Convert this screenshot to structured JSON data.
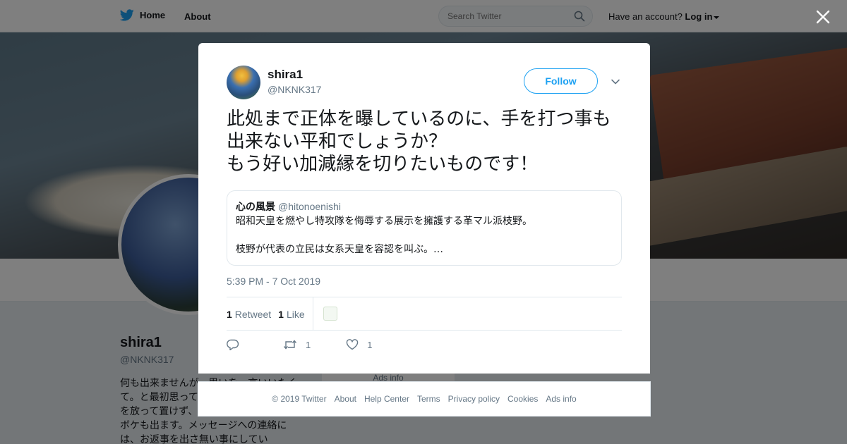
{
  "topbar": {
    "home_label": "Home",
    "about_label": "About",
    "search_placeholder": "Search Twitter",
    "have_account": "Have an account?",
    "login_label": "Log in"
  },
  "profile": {
    "name": "shira1",
    "handle": "@NKNK317",
    "bio": "何も出来ませんが、思いを一言いいたくて。と最初思って始めましたが、此の国を放って置けず、物申す方向になり時々ボケも出ます。メッセージへの連絡には、お返事を出さ無い事にしてい",
    "ads_info": "Ads info"
  },
  "tweet": {
    "author_name": "shira1",
    "author_handle": "@NKNK317",
    "follow_label": "Follow",
    "text": "此処まで正体を曝しているのに、手を打つ事も出来ない平和でしょうか？\nもう好い加減縁を切りたいものです！",
    "quoted": {
      "name": "心の風景",
      "handle": "@hitonoenishi",
      "line1": "昭和天皇を燃やし特攻隊を侮辱する展示を擁護する革マル派枝野。",
      "line2": "枝野が代表の立民は女系天皇を容認を叫ぶ。…"
    },
    "timestamp": "5:39 PM - 7 Oct 2019",
    "retweets_count": "1",
    "retweets_label": "Retweet",
    "likes_count": "1",
    "likes_label": "Like",
    "action_retweet_count": "1",
    "action_like_count": "1"
  },
  "footer": {
    "links": [
      "© 2019 Twitter",
      "About",
      "Help Center",
      "Terms",
      "Privacy policy",
      "Cookies",
      "Ads info"
    ]
  },
  "colors": {
    "accent": "#1da1f2",
    "text": "#14171a",
    "muted": "#657786",
    "border": "#e1e8ed"
  }
}
